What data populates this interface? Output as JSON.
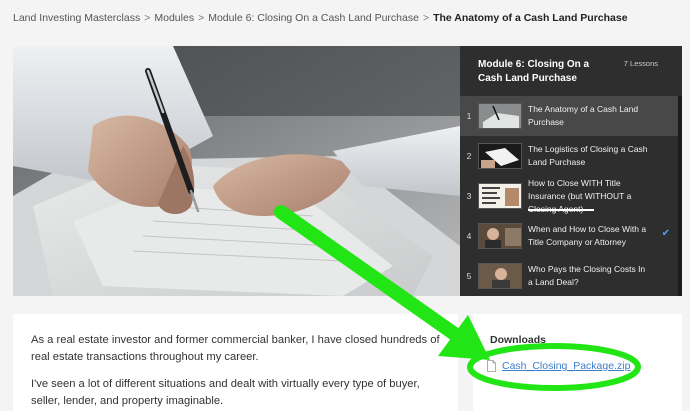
{
  "breadcrumb": {
    "items": [
      "Land Investing Masterclass",
      "Modules",
      "Module 6: Closing On a Cash Land Purchase"
    ],
    "separator": ">",
    "current": "The Anatomy of a Cash Land Purchase"
  },
  "sidebar": {
    "title": "Module 6: Closing On a Cash Land Purchase",
    "lesson_count": "7 Lessons",
    "lessons": [
      {
        "num": "1",
        "title": "The Anatomy of a Cash Land Purchase",
        "active": true,
        "completed": false
      },
      {
        "num": "2",
        "title": "The Logistics of Closing a Cash Land Purchase",
        "active": false,
        "completed": false
      },
      {
        "num": "3",
        "title": "How to Close WITH Title Insurance (but WITHOUT a Closing Agent)",
        "active": false,
        "completed": false
      },
      {
        "num": "4",
        "title": "When and How to Close With a Title Company or Attorney",
        "active": false,
        "completed": true
      },
      {
        "num": "5",
        "title": "Who Pays the Closing Costs In a Land Deal?",
        "active": false,
        "completed": false
      }
    ],
    "check_glyph": "✔"
  },
  "content": {
    "paragraphs": [
      "As a real estate investor and former commercial banker, I have closed hundreds of real estate transactions throughout my career.",
      "I've seen a lot of different situations and dealt with virtually every type of buyer, seller, lender, and property imaginable."
    ]
  },
  "downloads": {
    "heading": "Downloads",
    "file_name": "Cash_Closing_Package.zip",
    "file_icon": "document-icon"
  },
  "colors": {
    "sidebar_bg": "#2e2e2e",
    "sidebar_active": "#484848",
    "link": "#3a7dc9",
    "annotation_green": "#22e515",
    "check_blue": "#4aa3ff"
  }
}
